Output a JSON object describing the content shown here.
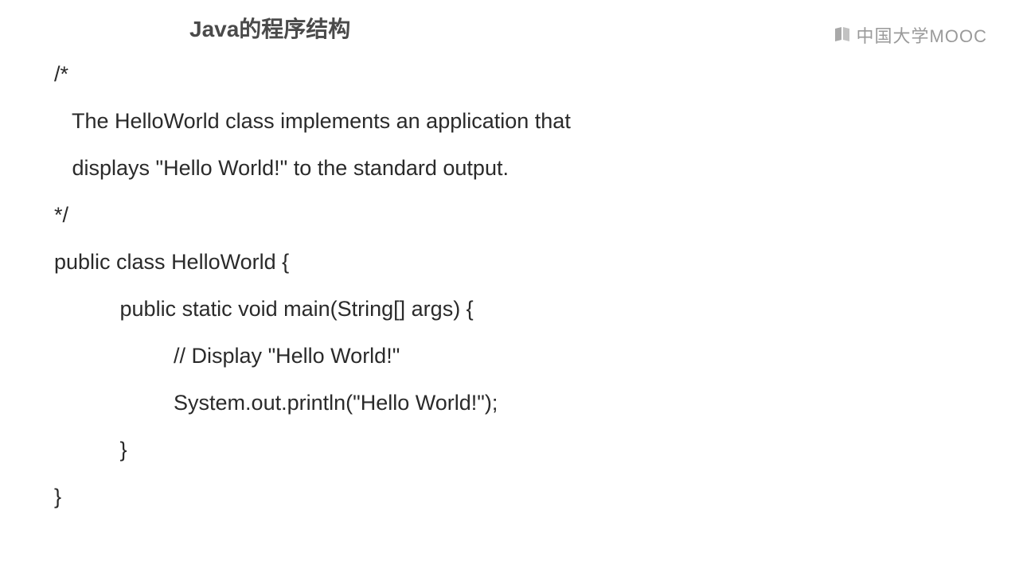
{
  "header": {
    "title": "Java的程序结构",
    "logo_text": "中国大学MOOC"
  },
  "code": {
    "line1": "/*",
    "line2": "   The HelloWorld class implements an application that",
    "line3": "   displays \"Hello World!\" to the standard output.",
    "line4": "*/",
    "line5": "public class HelloWorld {",
    "line6": "           public static void main(String[] args) {",
    "line7": "                    // Display \"Hello World!\"",
    "line8": "                    System.out.println(\"Hello World!\");",
    "line9": "           }",
    "line10": "}"
  }
}
